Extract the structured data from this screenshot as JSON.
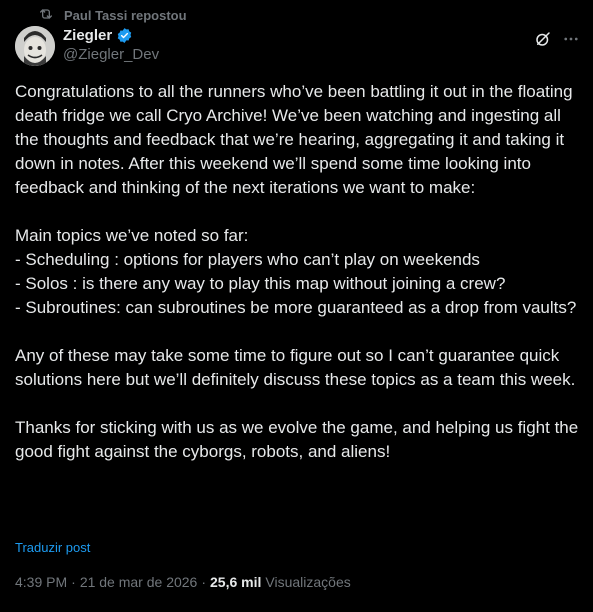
{
  "repost": {
    "label": "Paul Tassi repostou",
    "icon": "repost-icon"
  },
  "author": {
    "name": "Ziegler",
    "handle": "@Ziegler_Dev",
    "verified": true
  },
  "actions": {
    "grok_icon": "grok-icon",
    "more_icon": "more-icon"
  },
  "tweet": {
    "paragraphs": [
      "Congratulations to all the runners who’ve been battling it out in the floating death fridge we call Cryo Archive! We’ve been watching and ingesting all the thoughts and feedback that we’re hearing, aggregating it and taking it down in notes. After this weekend we’ll spend some time looking into feedback and thinking of the next iterations we want to make:",
      "Main topics we’ve noted so far:",
      "- Scheduling : options for players who can’t play on weekends",
      "- Solos : is there any way to play this map without joining a crew?",
      "- Subroutines: can subroutines be more guaranteed as a drop from vaults?",
      "Any of these may take some time to figure out so I can’t guarantee quick solutions here but we’ll definitely discuss these topics as a team this week.",
      "Thanks for sticking with us as we evolve the game, and helping us fight the good fight against the cyborgs, robots, and aliens!"
    ],
    "translate": "Traduzir post"
  },
  "meta": {
    "time": "4:39 PM",
    "separator": "·",
    "date": "21 de mar de 2026",
    "views_count": "25,6 mil",
    "views_label": "Visualizações"
  },
  "colors": {
    "background": "#000000",
    "text": "#e7e9ea",
    "muted": "#71767b",
    "accent": "#1d9bf0"
  }
}
